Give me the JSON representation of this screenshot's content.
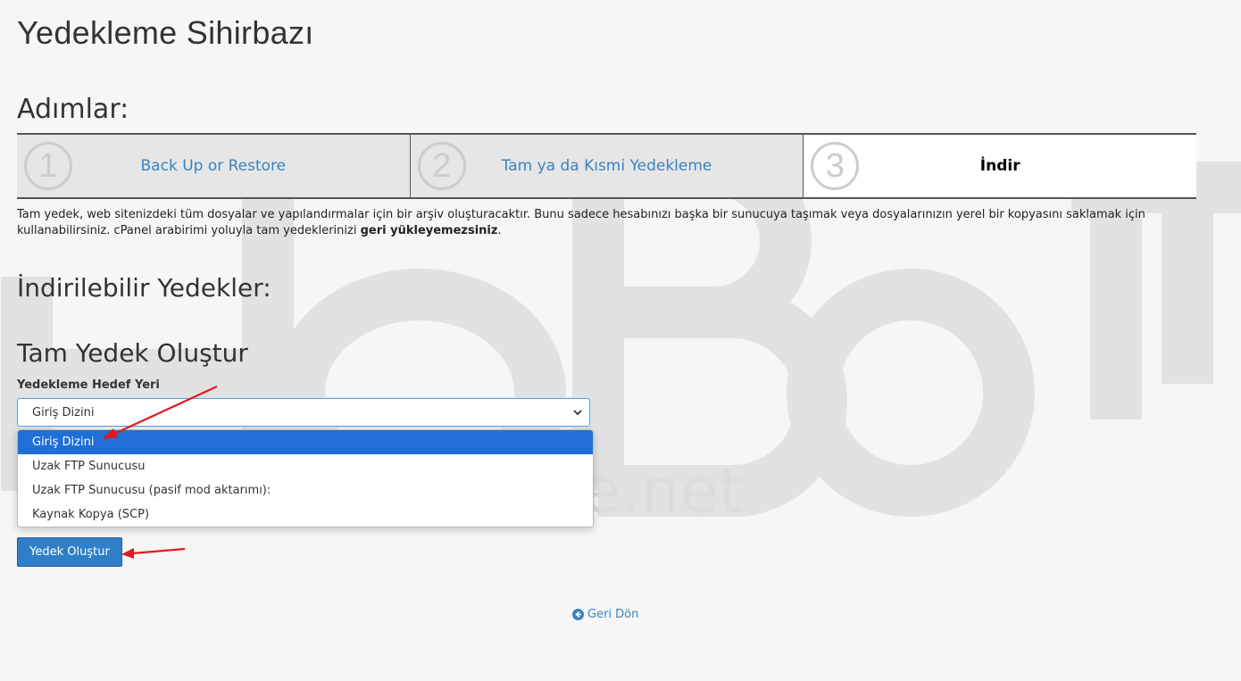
{
  "page": {
    "title": "Yedekleme Sihirbazı",
    "steps_title": "Adımlar:",
    "steps": [
      {
        "number": "1",
        "label": "Back Up or Restore",
        "active": false
      },
      {
        "number": "2",
        "label": "Tam ya da Kısmi Yedekleme",
        "active": false
      },
      {
        "number": "3",
        "label": "İndir",
        "active": true
      }
    ],
    "description_part1": "Tam yedek, web sitenizdeki tüm dosyalar ve yapılandırmalar için bir arşiv oluşturacaktır. Bunu sadece hesabınızı başka bir sunucuya taşımak veya dosyalarınızın yerel bir kopyasını saklamak için kullanabilirsiniz. cPanel arabirimi yoluyla tam yedeklerinizi ",
    "description_bold": "geri yükleyemezsiniz",
    "description_end": ".",
    "downloads_heading": "İndirilebilir Yedekler:",
    "create_heading": "Tam Yedek Oluştur"
  },
  "form": {
    "destination_label": "Yedekleme Hedef Yeri",
    "destination_value": "Giriş Dizini",
    "destination_options": [
      "Giriş Dizini",
      "Uzak FTP Sunucusu",
      "Uzak FTP Sunucusu (pasif mod aktarımı):",
      "Kaynak Kopya (SCP)"
    ],
    "submit_label": "Yedek Oluştur"
  },
  "footer": {
    "back_label": "Geri Dön"
  },
  "watermark": {
    "logo_text": "HeBeLe",
    "url_text": "www.hebele.net"
  },
  "colors": {
    "accent": "#2f7fc8",
    "link": "#3a83c0",
    "selected_option": "#1f6fd6",
    "annotation_arrow": "#e01b1b"
  }
}
